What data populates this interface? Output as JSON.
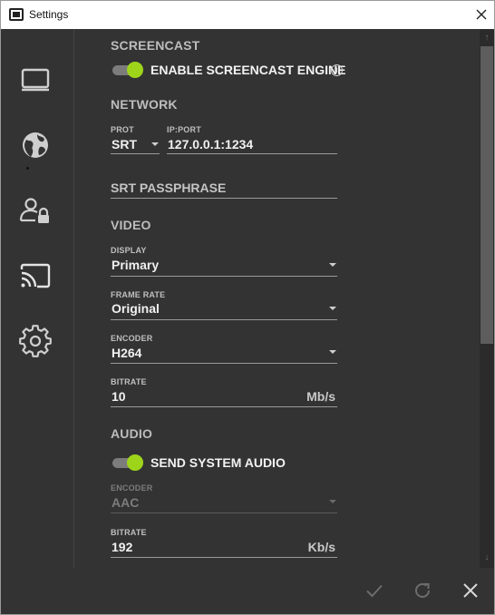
{
  "window": {
    "title": "Settings"
  },
  "sidebar": {
    "items": [
      {
        "icon": "monitor-icon"
      },
      {
        "icon": "globe-icon"
      },
      {
        "icon": "user-lock-icon"
      },
      {
        "icon": "cast-icon",
        "active": true
      },
      {
        "icon": "gear-icon"
      }
    ]
  },
  "screencast": {
    "section_title": "SCREENCAST",
    "enable_label": "ENABLE SCREENCAST ENGINE",
    "enabled": true
  },
  "network": {
    "section_title": "NETWORK",
    "prot_label": "PROT",
    "prot_value": "SRT",
    "ipport_label": "IP:PORT",
    "ipport_value": "127.0.0.1:1234",
    "passphrase_placeholder": "SRT PASSPHRASE"
  },
  "video": {
    "section_title": "VIDEO",
    "display_label": "DISPLAY",
    "display_value": "Primary",
    "framerate_label": "FRAME RATE",
    "framerate_value": "Original",
    "encoder_label": "ENCODER",
    "encoder_value": "H264",
    "bitrate_label": "BITRATE",
    "bitrate_value": "10",
    "bitrate_unit": "Mb/s"
  },
  "audio": {
    "section_title": "AUDIO",
    "send_label": "SEND SYSTEM AUDIO",
    "send_enabled": true,
    "encoder_label": "ENCODER",
    "encoder_value": "AAC",
    "bitrate_label": "BITRATE",
    "bitrate_value": "192",
    "bitrate_unit": "Kb/s"
  },
  "colors": {
    "accent": "#9ed51b",
    "background": "#333333",
    "text": "#f0f0f0"
  }
}
